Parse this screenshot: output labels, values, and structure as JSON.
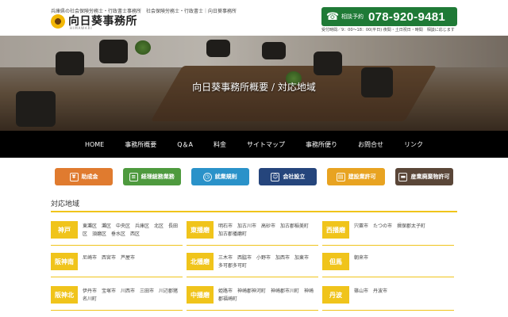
{
  "header": {
    "tagline": "兵庫県の社会保険労務士・行政書士事務所　社会保険労務士・行政書士｜向日葵事務所",
    "logo_text": "向日葵事務所",
    "logo_sub": "HIMAWARI",
    "phone_label": "相談予約",
    "phone_number": "078-920-9481",
    "hours": "受付時間／9：00～18：00(平日) 夜間・土日祝日・時間　相談に応じます"
  },
  "hero": {
    "title": "向日葵事務所概要 / 対応地域"
  },
  "nav": [
    "HOME",
    "事務所概要",
    "Q＆A",
    "料金",
    "サイトマップ",
    "事務所便り",
    "お問合せ",
    "リンク"
  ],
  "quick_buttons": [
    {
      "label": "助成金",
      "color": "#e07b2f",
      "icon": "yen-icon"
    },
    {
      "label": "経理総務業務",
      "color": "#4e9a3e",
      "icon": "document-icon"
    },
    {
      "label": "就業規則",
      "color": "#2a92c9",
      "icon": "clock-icon"
    },
    {
      "label": "会社設立",
      "color": "#25457c",
      "icon": "people-icon"
    },
    {
      "label": "建設業許可",
      "color": "#e8a321",
      "icon": "building-icon"
    },
    {
      "label": "産業廃棄物許可",
      "color": "#5a4638",
      "icon": "truck-icon"
    }
  ],
  "section": {
    "title": "対応地域"
  },
  "areas": [
    [
      {
        "region": "神戸",
        "cities": "東灘区　灘区　中央区　兵庫区　北区　長田区　須磨区　垂水区　西区"
      },
      {
        "region": "東播磨",
        "cities": "明石市　加古川市　高砂市　加古郡稲美町　加古郡播磨町"
      },
      {
        "region": "西播磨",
        "cities": "宍粟市　たつの市　揖保郡太子町"
      }
    ],
    [
      {
        "region": "阪神南",
        "cities": "尼崎市　西宮市　芦屋市"
      },
      {
        "region": "北播磨",
        "cities": "三木市　西脇市　小野市　加西市　加東市　多可郡多可町"
      },
      {
        "region": "但馬",
        "cities": "朝来市"
      }
    ],
    [
      {
        "region": "阪神北",
        "cities": "伊丹市　宝塚市　川西市　三田市　川辺郡猪名川町"
      },
      {
        "region": "中播磨",
        "cities": "姫路市　神崎郡神河町　神崎郡市川町　神崎郡福崎町"
      },
      {
        "region": "丹波",
        "cities": "篠山市　丹波市"
      }
    ]
  ],
  "colors": {
    "accent": "#f0c41b",
    "phone_bg": "#1f7a36",
    "nav_bg": "#000000"
  }
}
